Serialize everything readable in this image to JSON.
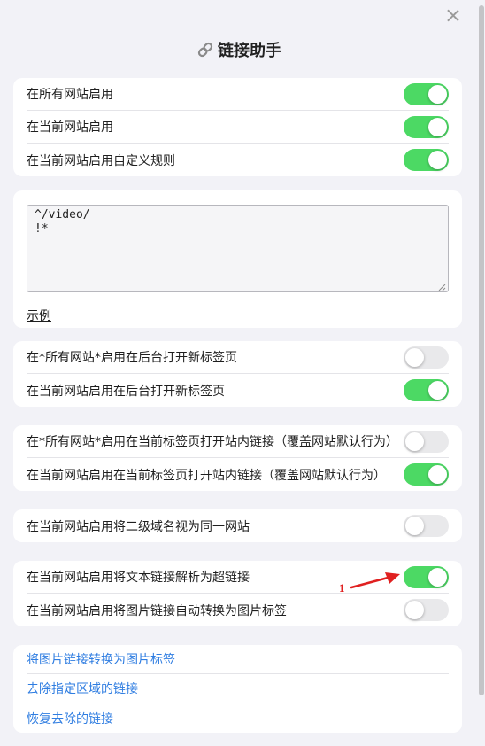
{
  "header": {
    "title": "链接助手",
    "icon": "link-icon"
  },
  "site_toggles": [
    {
      "label": "在所有网站启用",
      "on": true
    },
    {
      "label": "在当前网站启用",
      "on": true
    },
    {
      "label": "在当前网站启用自定义规则",
      "on": true
    }
  ],
  "rules": {
    "value": "^/video/\n!*",
    "example_label": "示例"
  },
  "background_tab": [
    {
      "label": "在*所有网站*启用在后台打开新标签页",
      "on": false
    },
    {
      "label": "在当前网站启用在后台打开新标签页",
      "on": true
    }
  ],
  "same_tab": [
    {
      "label": "在*所有网站*启用在当前标签页打开站内链接（覆盖网站默认行为）",
      "on": false
    },
    {
      "label": "在当前网站启用在当前标签页打开站内链接（覆盖网站默认行为）",
      "on": true
    }
  ],
  "domain": [
    {
      "label": "在当前网站启用将二级域名视为同一网站",
      "on": false
    }
  ],
  "parse": [
    {
      "label": "在当前网站启用将文本链接解析为超链接",
      "on": true
    },
    {
      "label": "在当前网站启用将图片链接自动转换为图片标签",
      "on": false
    }
  ],
  "actions": [
    {
      "label": "将图片链接转换为图片标签"
    },
    {
      "label": "去除指定区域的链接"
    },
    {
      "label": "恢复去除的链接"
    }
  ],
  "annotation": {
    "number": "1",
    "color": "#e02020"
  },
  "colors": {
    "toggle_on": "#4cd964",
    "toggle_off": "#e9e9eb",
    "link": "#2f7de1",
    "background": "#f2f2f7"
  }
}
